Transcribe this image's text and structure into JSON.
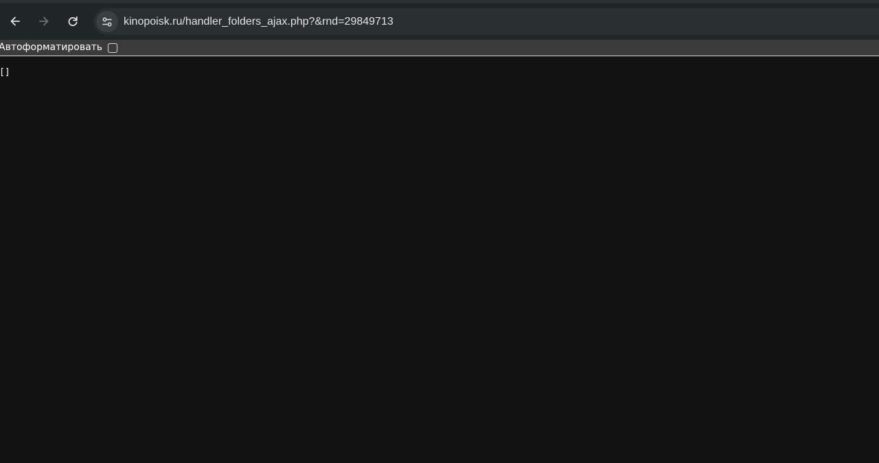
{
  "browser": {
    "address_bar": {
      "url": "kinopoisk.ru/handler_folders_ajax.php?&rnd=29849713"
    },
    "icons": {
      "back": "arrow-left-icon",
      "forward": "arrow-right-icon",
      "reload": "reload-icon",
      "site_info": "tune-icon"
    }
  },
  "json_viewer": {
    "autoformat_label": "Автоформатировать",
    "autoformat_checked": false
  },
  "content": {
    "body_text": "[]"
  },
  "colors": {
    "page_background": "#121212",
    "toolbar_background": "#202526",
    "omnibox_background": "#2a2f31",
    "format_bar_background": "#3b3b3b"
  }
}
